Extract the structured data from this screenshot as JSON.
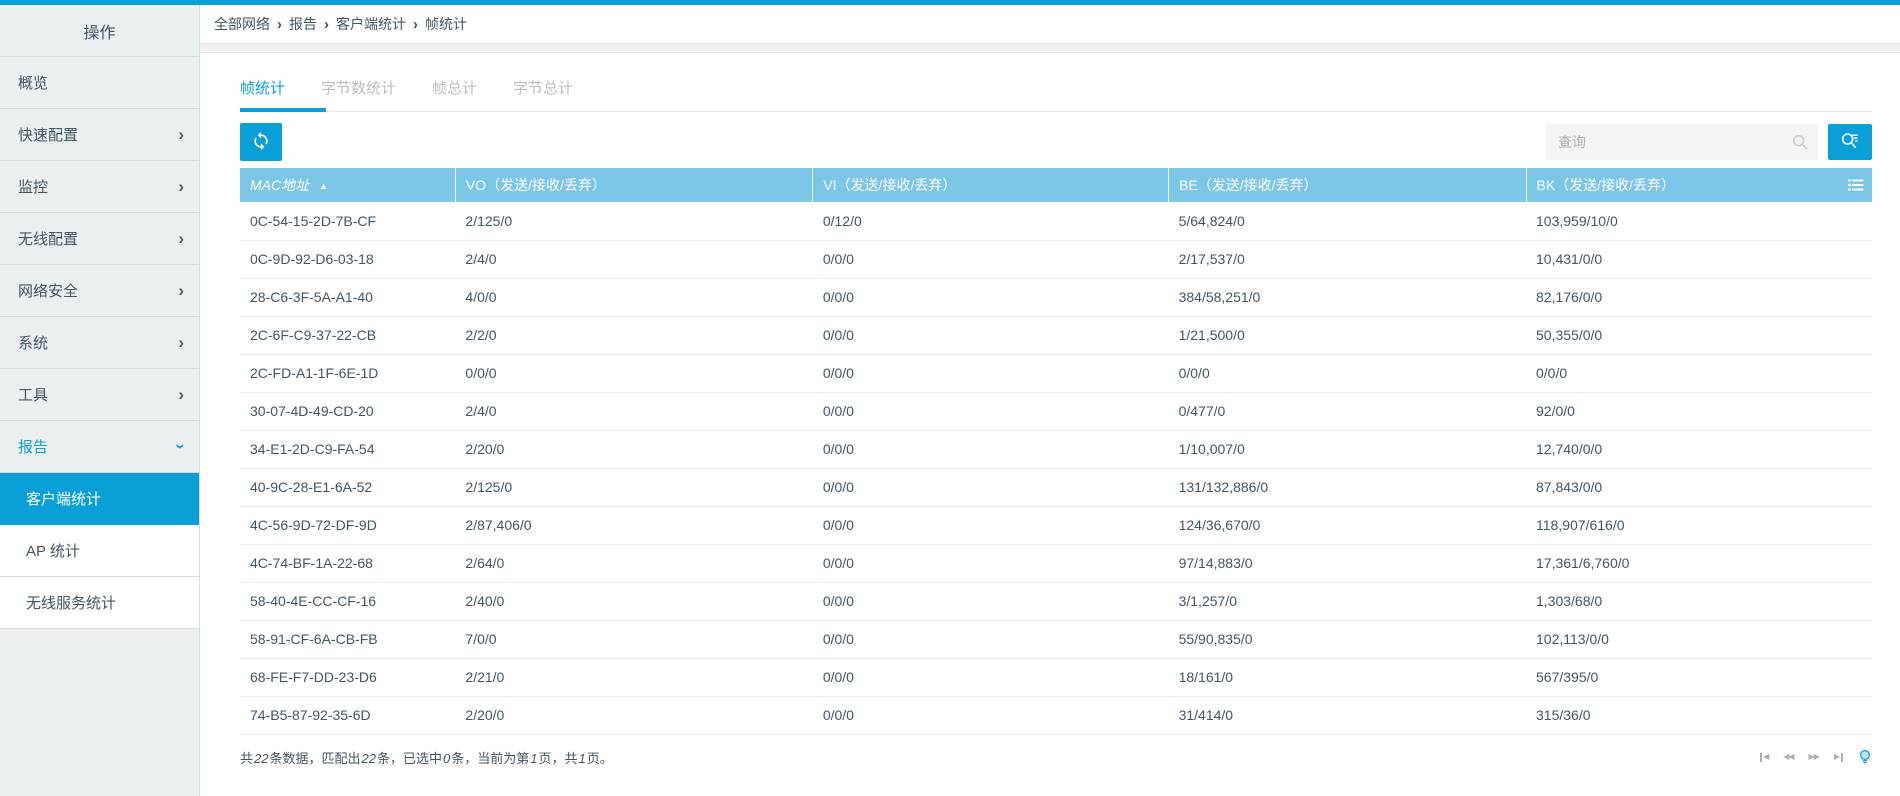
{
  "colors": {
    "accent": "#0B9FD8",
    "table_header_bg": "#7CC6E8",
    "sidebar_bg": "#ECEFEF",
    "text": "#425563"
  },
  "sidebar": {
    "title": "操作",
    "items": [
      {
        "label": "概览",
        "chevron": null,
        "expanded": false
      },
      {
        "label": "快速配置",
        "chevron": "right",
        "expanded": false
      },
      {
        "label": "监控",
        "chevron": "right",
        "expanded": false
      },
      {
        "label": "无线配置",
        "chevron": "right",
        "expanded": false
      },
      {
        "label": "网络安全",
        "chevron": "right",
        "expanded": false
      },
      {
        "label": "系统",
        "chevron": "right",
        "expanded": false
      },
      {
        "label": "工具",
        "chevron": "right",
        "expanded": false
      },
      {
        "label": "报告",
        "chevron": "down",
        "expanded": true
      }
    ],
    "submenu": [
      {
        "label": "客户端统计",
        "active": true
      },
      {
        "label": "AP 统计",
        "active": false
      },
      {
        "label": "无线服务统计",
        "active": false
      }
    ]
  },
  "breadcrumb": {
    "items": [
      "全部网络",
      "报告",
      "客户端统计",
      "帧统计"
    ],
    "separator": "›"
  },
  "tabs": [
    {
      "label": "帧统计",
      "active": true
    },
    {
      "label": "字节数统计",
      "active": false
    },
    {
      "label": "帧总计",
      "active": false
    },
    {
      "label": "字节总计",
      "active": false
    }
  ],
  "toolbar": {
    "refresh_icon": "refresh-icon",
    "search_placeholder": "查询",
    "search_icon": "magnifier-icon",
    "advanced_search_icon": "magnifier-filter-icon"
  },
  "table": {
    "sort_indicator": "▲",
    "column_chooser_icon": "column-list-icon",
    "columns": [
      {
        "label": "MAC地址",
        "sorted": "asc",
        "italic": true
      },
      {
        "label": "VO（发送/接收/丢弃）",
        "sorted": null,
        "italic": false
      },
      {
        "label": "VI（发送/接收/丢弃）",
        "sorted": null,
        "italic": false
      },
      {
        "label": "BE（发送/接收/丢弃）",
        "sorted": null,
        "italic": false
      },
      {
        "label": "BK（发送/接收/丢弃）",
        "sorted": null,
        "italic": false
      }
    ],
    "rows": [
      [
        "0C-54-15-2D-7B-CF",
        "2/125/0",
        "0/12/0",
        "5/64,824/0",
        "103,959/10/0"
      ],
      [
        "0C-9D-92-D6-03-18",
        "2/4/0",
        "0/0/0",
        "2/17,537/0",
        "10,431/0/0"
      ],
      [
        "28-C6-3F-5A-A1-40",
        "4/0/0",
        "0/0/0",
        "384/58,251/0",
        "82,176/0/0"
      ],
      [
        "2C-6F-C9-37-22-CB",
        "2/2/0",
        "0/0/0",
        "1/21,500/0",
        "50,355/0/0"
      ],
      [
        "2C-FD-A1-1F-6E-1D",
        "0/0/0",
        "0/0/0",
        "0/0/0",
        "0/0/0"
      ],
      [
        "30-07-4D-49-CD-20",
        "2/4/0",
        "0/0/0",
        "0/477/0",
        "92/0/0"
      ],
      [
        "34-E1-2D-C9-FA-54",
        "2/20/0",
        "0/0/0",
        "1/10,007/0",
        "12,740/0/0"
      ],
      [
        "40-9C-28-E1-6A-52",
        "2/125/0",
        "0/0/0",
        "131/132,886/0",
        "87,843/0/0"
      ],
      [
        "4C-56-9D-72-DF-9D",
        "2/87,406/0",
        "0/0/0",
        "124/36,670/0",
        "118,907/616/0"
      ],
      [
        "4C-74-BF-1A-22-68",
        "2/64/0",
        "0/0/0",
        "97/14,883/0",
        "17,361/6,760/0"
      ],
      [
        "58-40-4E-CC-CF-16",
        "2/40/0",
        "0/0/0",
        "3/1,257/0",
        "1,303/68/0"
      ],
      [
        "58-91-CF-6A-CB-FB",
        "7/0/0",
        "0/0/0",
        "55/90,835/0",
        "102,113/0/0"
      ],
      [
        "68-FE-F7-DD-23-D6",
        "2/21/0",
        "0/0/0",
        "18/161/0",
        "567/395/0"
      ],
      [
        "74-B5-87-92-35-6D",
        "2/20/0",
        "0/0/0",
        "31/414/0",
        "315/36/0"
      ]
    ]
  },
  "footer": {
    "summary_parts": [
      {
        "text": "共"
      },
      {
        "text": "22",
        "em": true
      },
      {
        "text": "条数据，匹配出"
      },
      {
        "text": "22",
        "em": true
      },
      {
        "text": "条，已选中"
      },
      {
        "text": "0",
        "em": true
      },
      {
        "text": "条，当前为第"
      },
      {
        "text": "1",
        "em": true
      },
      {
        "text": "页，共"
      },
      {
        "text": "1",
        "em": true
      },
      {
        "text": "页。"
      }
    ],
    "pager": [
      {
        "name": "page-first-button",
        "type": "first"
      },
      {
        "name": "page-prev-button",
        "type": "prev"
      },
      {
        "name": "page-next-button",
        "type": "next"
      },
      {
        "name": "page-last-button",
        "type": "last"
      },
      {
        "name": "tip-lightbulb-button",
        "type": "lightbulb"
      }
    ]
  }
}
